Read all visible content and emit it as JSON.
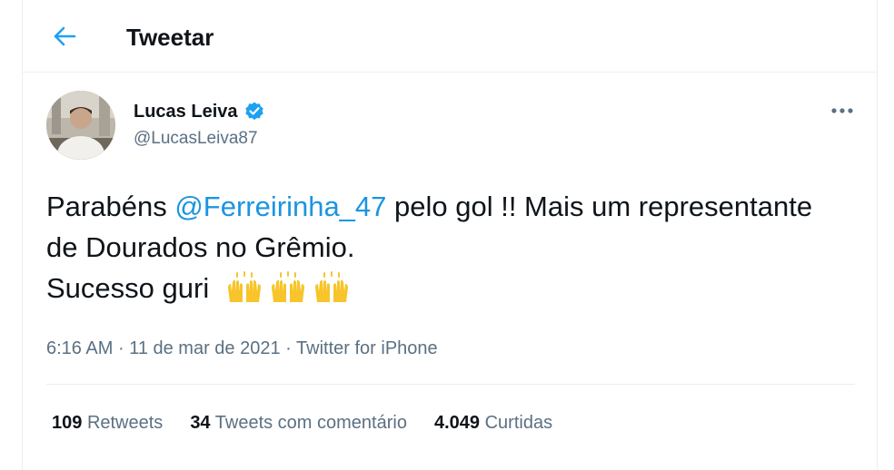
{
  "header": {
    "title": "Tweetar",
    "back_icon": "arrow-left-icon"
  },
  "author": {
    "name": "Lucas Leiva",
    "handle": "@LucasLeiva87",
    "verified_icon": "verified-badge-icon"
  },
  "tweet": {
    "text_before": "Parabéns ",
    "mention": "@Ferreirinha_47",
    "text_after": " pelo gol !! Mais um representante de Dourados no Grêmio.",
    "line3": "Sucesso guri",
    "emojis": [
      "raising-hands-emoji",
      "raising-hands-emoji",
      "raising-hands-emoji"
    ]
  },
  "meta": {
    "time": "6:16 AM",
    "separator": "·",
    "date": "11 de mar de 2021",
    "source": "Twitter for iPhone"
  },
  "stats": {
    "retweets_count": "109",
    "retweets_label": "Retweets",
    "quotes_count": "34",
    "quotes_label": "Tweets com comentário",
    "likes_count": "4.049",
    "likes_label": "Curtidas"
  },
  "colors": {
    "accent": "#1da1f2",
    "link": "#1b95e0",
    "muted": "#5b7083",
    "text": "#0f1419",
    "border": "#ebeef0",
    "emoji": "#f7c52b"
  }
}
